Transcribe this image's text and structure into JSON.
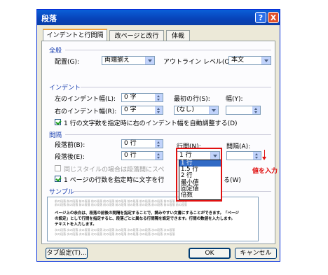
{
  "dialog": {
    "title": "段落",
    "help_label": "?",
    "close_label": "X",
    "tabs": [
      "インデントと行間隔",
      "改ページと改行",
      "体裁"
    ],
    "general": {
      "heading": "全般",
      "alignment_label": "配置(G):",
      "alignment_value": "両端揃え",
      "outline_label": "アウトライン レベル(O):",
      "outline_value": "本文"
    },
    "indent": {
      "heading": "インデント",
      "left_label": "左のインデント幅(L):",
      "left_value": "0 字",
      "right_label": "右のインデント幅(R):",
      "right_value": "0 字",
      "first_line_label": "最初の行(S):",
      "first_line_value": "(なし)",
      "width_label": "幅(Y):",
      "width_value": "",
      "auto_adjust_label": "1 行の文字数を指定時に右のインデント幅を自動調整する(D)",
      "auto_adjust_checked": true
    },
    "spacing": {
      "heading": "間隔",
      "before_label": "段落前(B):",
      "before_value": "0 行",
      "after_label": "段落後(E):",
      "after_value": "0 行",
      "line_spacing_label": "行間(N):",
      "line_spacing_value": "1 行",
      "at_label": "間隔(A):",
      "at_value": "",
      "same_style_label": "同じスタイルの場合は段落間にスペ",
      "same_style_checked": false,
      "grid_label_left": "1 ページの行数を指定時に文字を行",
      "grid_label_right": "る(W)",
      "grid_checked": true,
      "line_spacing_options": [
        "1 行",
        "1.5 行",
        "2 行",
        "最小値",
        "固定値",
        "倍数"
      ],
      "selected_option_index": 0
    },
    "annotation": "値を入力",
    "preview": {
      "heading": "サンプル",
      "sample_before": "前の段落 前の段落 前の段落 前の段落 前の段落 前の段落 前の段落 前の段落 前の段落 前の段落 前の段落",
      "sample_main_1": "ページ上の余白は、段落の前後の間隔を指定することで、読みやすい文書にすることができます。「ページ",
      "sample_main_2": "の設定」として行間を指定すると、段落ごとに異なる行間隔を設定できます。行間の数値を入力します。",
      "sample_main_3": "テキストを入力します。",
      "sample_after": "次の段落 次の段落 次の段落 次の段落 次の段落 次の段落 次の段落 次の段落 次の段落 次の段落"
    },
    "tabs_button": "タブ設定(T)...",
    "ok_button": "OK",
    "cancel_button": "キャンセル"
  }
}
